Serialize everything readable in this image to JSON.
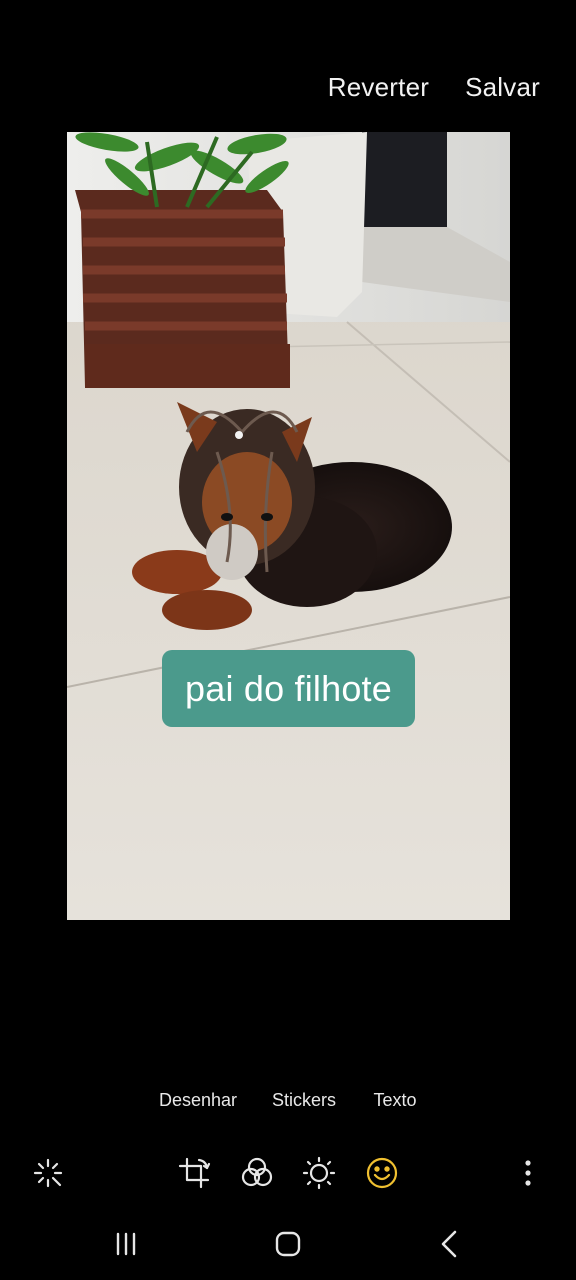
{
  "header": {
    "revert_label": "Reverter",
    "save_label": "Salvar"
  },
  "canvas": {
    "photo_subject": "yorkshire terrier lying on tiled floor next to potted plant",
    "sticker_text": "pai do filhote",
    "sticker_color": "#4b9a8c"
  },
  "subtools": {
    "draw_label": "Desenhar",
    "stickers_label": "Stickers",
    "text_label": "Texto"
  },
  "toolbar": {
    "icons": [
      "auto-enhance-icon",
      "crop-rotate-icon",
      "filters-icon",
      "adjust-icon",
      "decorations-icon",
      "more-options-icon"
    ],
    "active_icon": "decorations-icon",
    "active_color": "#f0c030"
  },
  "navbar": {
    "icons": [
      "recent-apps-icon",
      "home-icon",
      "back-icon"
    ]
  }
}
